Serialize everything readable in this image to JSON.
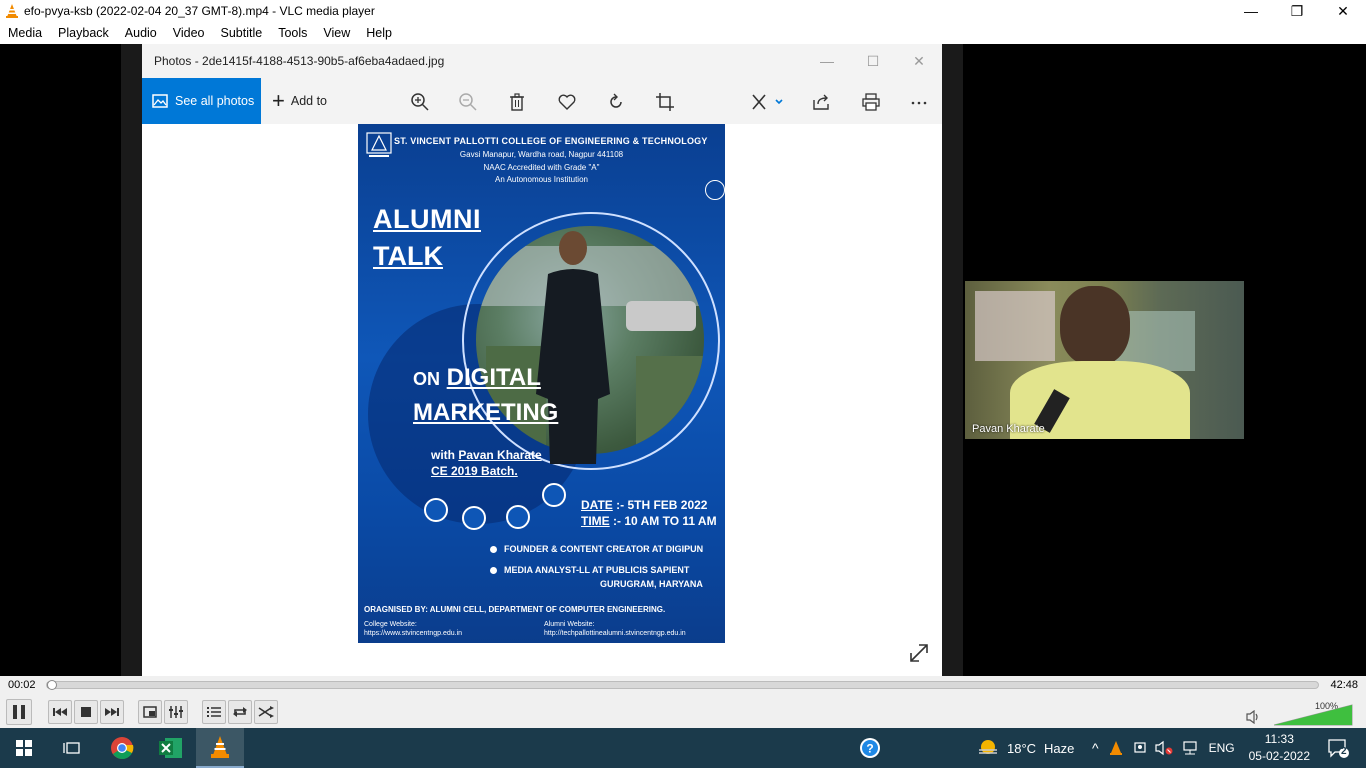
{
  "window": {
    "title": "efo-pvya-ksb (2022-02-04 20_37 GMT-8).mp4 - VLC media player",
    "minimize": "—",
    "restore": "❐",
    "close": "✕"
  },
  "menu": [
    "Media",
    "Playback",
    "Audio",
    "Video",
    "Subtitle",
    "Tools",
    "View",
    "Help"
  ],
  "photos": {
    "title": "Photos - 2de1415f-4188-4513-90b5-af6eba4adaed.jpg",
    "see_all": "See all photos",
    "add_to": "Add to",
    "toolbar_icons": [
      "zoom-in-icon",
      "zoom-out-icon",
      "delete-icon",
      "favorite-icon",
      "rotate-icon",
      "crop-icon",
      "edit-icon",
      "share-icon",
      "print-icon",
      "more-icon"
    ]
  },
  "poster": {
    "college": "ST. VINCENT PALLOTTI COLLEGE OF ENGINEERING & TECHNOLOGY",
    "address": "Gavsi Manapur, Wardha road, Nagpur 441108",
    "naac": "NAAC Accredited with Grade \"A\"",
    "autonomous": "An Autonomous Institution",
    "alumni": "ALUMNI",
    "talk": "TALK",
    "on": "ON",
    "digital": "DIGITAL",
    "marketing": "MARKETING",
    "with": "with",
    "speaker": "Pavan Kharate",
    "batch": "CE 2019 Batch.",
    "date_label": "DATE",
    "date_value": ":- 5TH FEB 2022",
    "time_label": "TIME",
    "time_value": ":- 10 AM TO 11 AM",
    "role1": "FOUNDER & CONTENT CREATOR AT DIGIPUN",
    "role2": "MEDIA ANALYST-LL AT PUBLICIS SAPIENT",
    "role2_loc": "GURUGRAM, HARYANA",
    "organised": "ORAGNISED BY: ALUMNI CELL, DEPARTMENT OF COMPUTER ENGINEERING.",
    "college_site_label": "College Website:",
    "college_site": "https://www.stvincentngp.edu.in",
    "alumni_site_label": "Alumni Website:",
    "alumni_site": "http://techpallottinealumni.stvincentngp.edu.in"
  },
  "webcam": {
    "name": "Pavan Kharate"
  },
  "player": {
    "current_time": "00:02",
    "total_time": "42:48",
    "progress": 0.001,
    "volume_pct": "100%",
    "volume": 1.0
  },
  "taskbar": {
    "weather_temp": "18°C",
    "weather_desc": "Haze",
    "lang": "ENG",
    "time": "11:33",
    "date": "05-02-2022",
    "notifications": "2"
  }
}
